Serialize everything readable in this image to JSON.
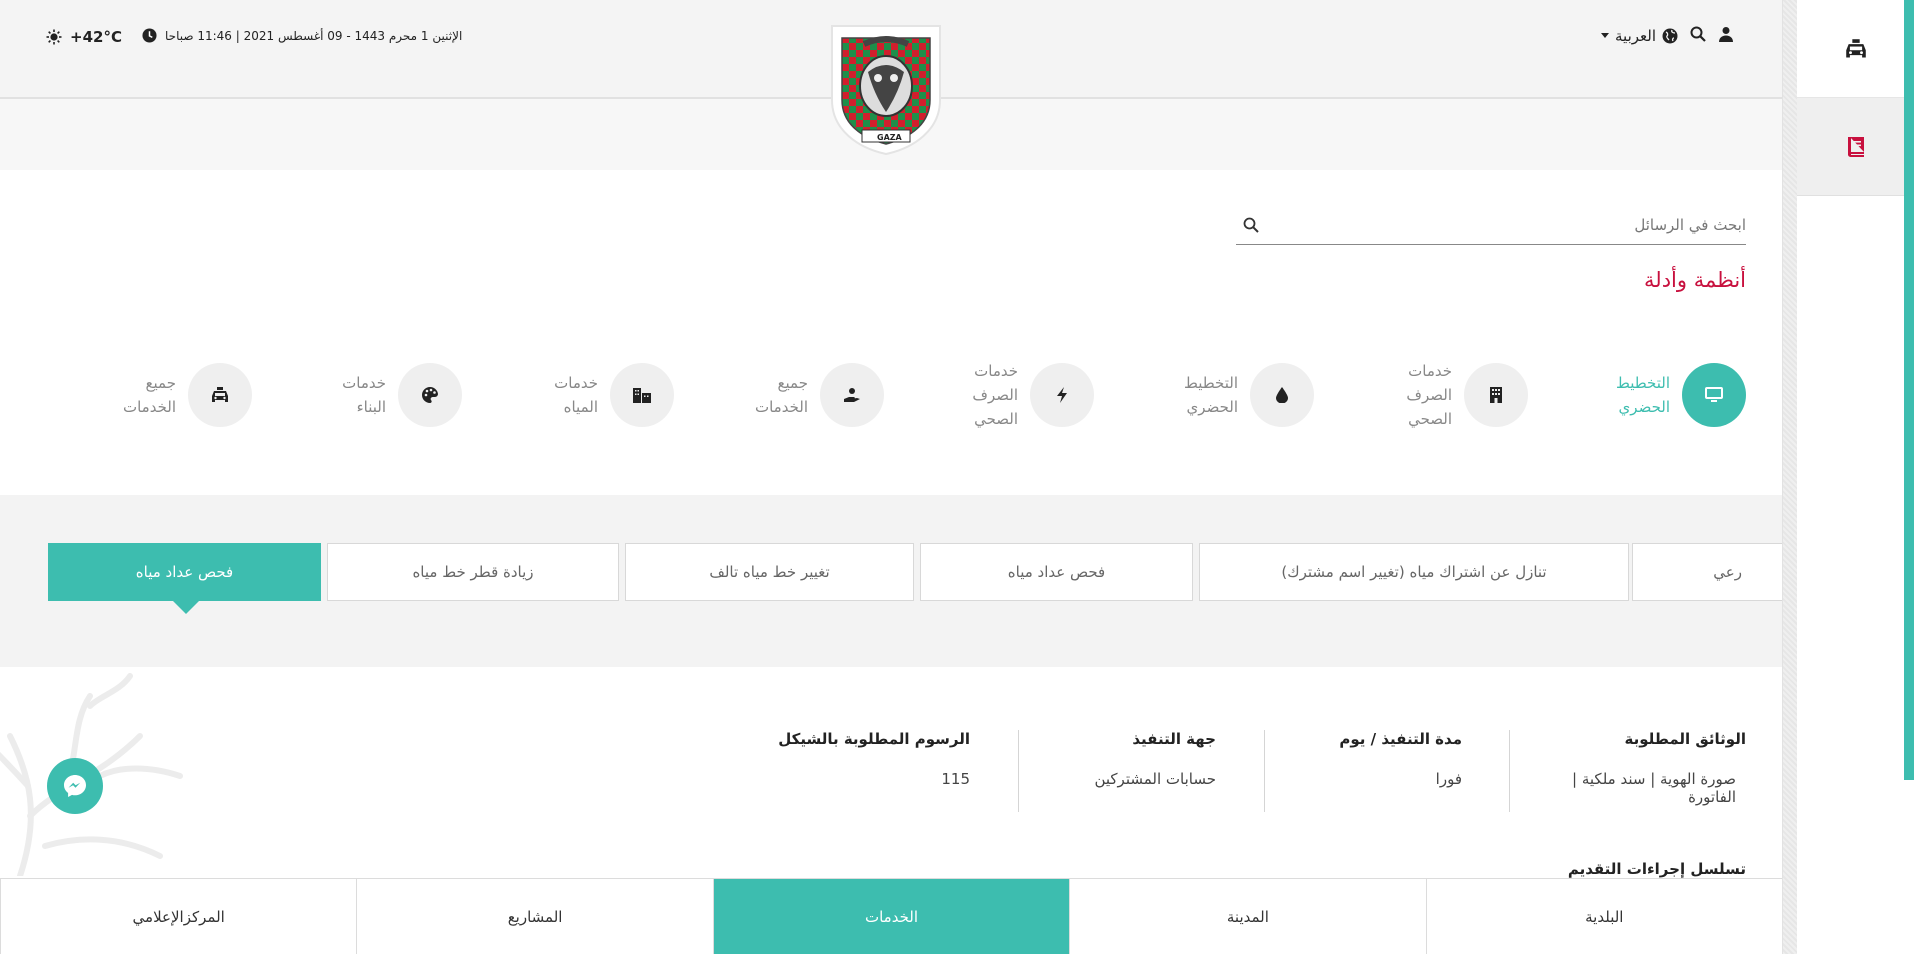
{
  "header": {
    "temperature": "+42°C",
    "datetime": "الإثنين 1 محرم 1443 - 09 أغسطس 2021 | 11:46 صباحا",
    "language": "العربية",
    "crest_text": "GAZA"
  },
  "search": {
    "placeholder": "ابحث في الرسائل"
  },
  "section": {
    "title": "أنظمة وأدلة"
  },
  "categories": [
    {
      "label": "التخطيط الحضري",
      "icon": "monitor-icon",
      "active": true
    },
    {
      "label": "خدمات الصرف الصحي",
      "icon": "building-icon"
    },
    {
      "label": "التخطيط الحضري",
      "icon": "water-drop-icon"
    },
    {
      "label": "خدمات الصرف الصحي",
      "icon": "bolt-icon"
    },
    {
      "label": "جميع الخدمات",
      "icon": "hand-icon"
    },
    {
      "label": "خدمات المياه",
      "icon": "city-icon"
    },
    {
      "label": "خدمات البناء",
      "icon": "palette-icon"
    },
    {
      "label": "جميع الخدمات",
      "icon": "taxi-icon"
    }
  ],
  "service_tabs": [
    {
      "label": "رعي"
    },
    {
      "label": "تنازل عن اشتراك مياه (تغيير اسم مشترك)"
    },
    {
      "label": "فحص عداد مياه"
    },
    {
      "label": "تغيير خط مياه تالف"
    },
    {
      "label": "زيادة قطر خط مياه"
    },
    {
      "label": "فحص عداد مياه",
      "active": true
    }
  ],
  "details": {
    "documents": {
      "heading": "الوثائق المطلوبة",
      "value": "صورة الهوية | سند ملكية | الفاتورة"
    },
    "duration": {
      "heading": "مدة التنفيذ / يوم",
      "value": "فورا"
    },
    "authority": {
      "heading": "جهة التنفيذ",
      "value": "حسابات المشتركين"
    },
    "fees": {
      "heading": "الرسوم المطلوبة بالشيكل",
      "value": "115"
    },
    "steps_heading": "تسلسل إجراءات التقديم"
  },
  "bottom_nav": [
    {
      "label": "البلدية"
    },
    {
      "label": "المدينة"
    },
    {
      "label": "الخدمات",
      "active": true
    },
    {
      "label": "المشاريع"
    },
    {
      "label": "المركزالإعلامي"
    }
  ],
  "colors": {
    "accent": "#3dbdaf",
    "title_red": "#c8103e"
  }
}
